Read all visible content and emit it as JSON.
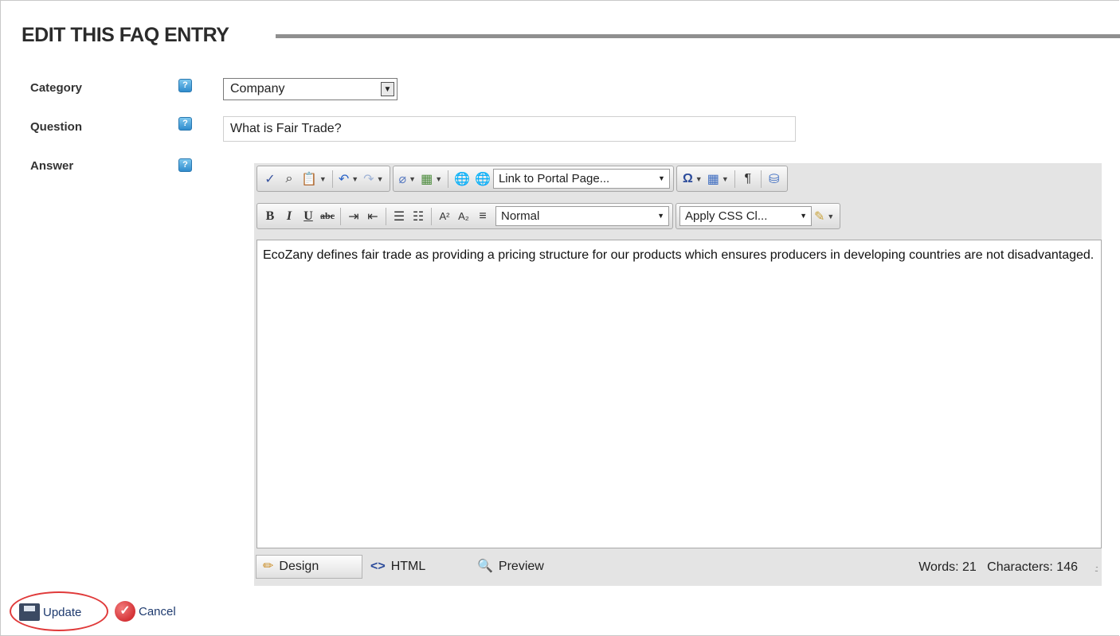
{
  "page": {
    "title": "EDIT THIS FAQ ENTRY"
  },
  "form": {
    "category_label": "Category",
    "category_value": "Company",
    "question_label": "Question",
    "question_value": "What is Fair Trade?",
    "answer_label": "Answer",
    "help_glyph": "?"
  },
  "editor": {
    "link_select": "Link to Portal Page...",
    "format_select": "Normal",
    "css_select": "Apply CSS Cl...",
    "content": "EcoZany defines fair trade as providing a pricing structure for our products which ensures producers in developing countries are not disadvantaged.",
    "modes": {
      "design": "Design",
      "html": "HTML",
      "preview": "Preview"
    },
    "words": "Words: 21",
    "characters": "Characters: 146"
  },
  "actions": {
    "update": "Update",
    "cancel": "Cancel"
  },
  "icons": {
    "spellcheck": "spellcheck-icon",
    "find": "find-replace-icon",
    "paste": "paste-icon",
    "undo": "undo-icon",
    "redo": "redo-icon",
    "link": "hyperlink-icon",
    "image_manager": "image-manager-icon",
    "insert_link": "insert-link-icon",
    "remove_link": "remove-link-icon",
    "symbol": "special-characters-icon",
    "table": "insert-table-icon",
    "paragraph": "paragraph-icon",
    "module": "module-icon"
  },
  "colors": {
    "accent_rule": "#8f8f8f",
    "help_icon": "#2f8ccd",
    "highlight_ring": "#e03a3a"
  }
}
